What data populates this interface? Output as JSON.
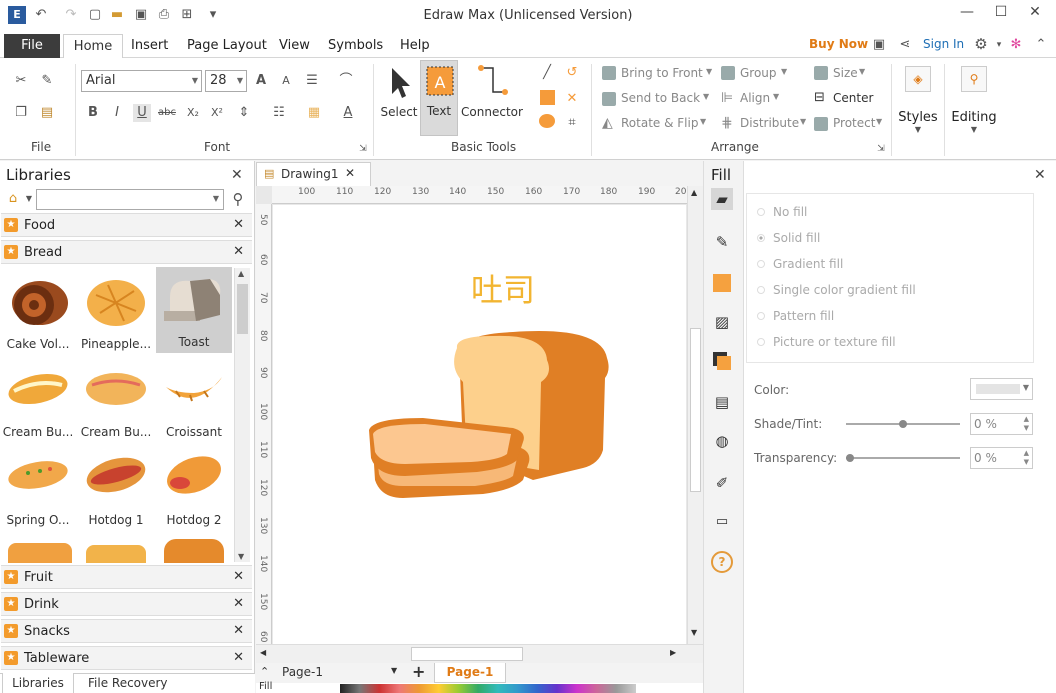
{
  "app": {
    "title": "Edraw Max (Unlicensed Version)"
  },
  "menu": {
    "file": "File",
    "tabs": [
      "Home",
      "Insert",
      "Page Layout",
      "View",
      "Symbols",
      "Help"
    ],
    "buy_now": "Buy Now",
    "sign_in": "Sign In"
  },
  "ribbon": {
    "font_name": "Arial",
    "font_size": "28",
    "groups": {
      "file": "File",
      "font": "Font",
      "basic_tools": "Basic Tools",
      "arrange": "Arrange"
    },
    "tools": {
      "select": "Select",
      "text": "Text",
      "connector": "Connector"
    },
    "arrange": {
      "bring_to_front": "Bring to Front",
      "send_to_back": "Send to Back",
      "rotate_flip": "Rotate & Flip",
      "group": "Group",
      "align": "Align",
      "distribute": "Distribute",
      "size": "Size",
      "center": "Center",
      "protect": "Protect"
    },
    "styles": "Styles",
    "editing": "Editing"
  },
  "libraries": {
    "title": "Libraries",
    "categories_top": [
      "Food",
      "Bread"
    ],
    "shapes": [
      {
        "label": "Cake Vol..."
      },
      {
        "label": "Pineapple..."
      },
      {
        "label": "Toast"
      },
      {
        "label": "Cream Bu..."
      },
      {
        "label": "Cream Bu..."
      },
      {
        "label": "Croissant"
      },
      {
        "label": "Spring O..."
      },
      {
        "label": "Hotdog 1"
      },
      {
        "label": "Hotdog 2"
      }
    ],
    "categories_bottom": [
      "Fruit",
      "Drink",
      "Snacks",
      "Tableware"
    ],
    "tabs": [
      "Libraries",
      "File Recovery"
    ]
  },
  "document": {
    "tab": "Drawing1",
    "canvas_text": "吐司",
    "ruler_top": [
      "100",
      "110",
      "120",
      "130",
      "140",
      "150",
      "160",
      "170",
      "180",
      "190",
      "20"
    ],
    "ruler_left": [
      "50",
      "60",
      "70",
      "80",
      "90",
      "100",
      "110",
      "120",
      "130",
      "140",
      "150",
      "60"
    ],
    "page_select": "Page-1",
    "page_tab": "Page-1",
    "fill_label": "Fill"
  },
  "fill_panel": {
    "title": "Fill",
    "options": [
      "No fill",
      "Solid fill",
      "Gradient fill",
      "Single color gradient fill",
      "Pattern fill",
      "Picture or texture fill"
    ],
    "color_label": "Color:",
    "shade_label": "Shade/Tint:",
    "shade_value": "0 %",
    "transparency_label": "Transparency:",
    "transparency_value": "0 %"
  },
  "colors": {
    "accent": "#e07b16",
    "canvas_text": "#f2b531"
  }
}
